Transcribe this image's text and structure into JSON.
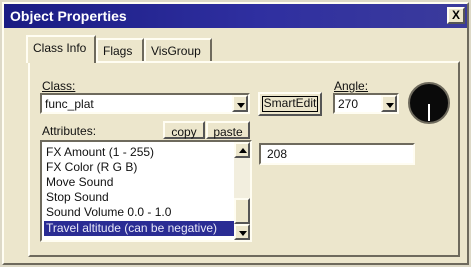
{
  "window": {
    "title": "Object Properties",
    "close_label": "X"
  },
  "tabs": [
    {
      "label": "Class Info",
      "active": true
    },
    {
      "label": "Flags",
      "active": false
    },
    {
      "label": "VisGroup",
      "active": false
    }
  ],
  "class_section": {
    "label": "Class:",
    "value": "func_plat"
  },
  "smartedit_label": "SmartEdit",
  "angle": {
    "label": "Angle:",
    "value": "270",
    "dial_degrees": 270
  },
  "attributes": {
    "label": "Attributes:",
    "copy_label": "copy",
    "paste_label": "paste",
    "items": [
      "FX Amount (1 - 255)",
      "FX Color (R G B)",
      "Move Sound",
      "Stop Sound",
      "Sound Volume 0.0 - 1.0",
      "Travel altitude (can be negative)"
    ],
    "selected_index": 5
  },
  "value_field": {
    "value": "208"
  },
  "colors": {
    "titlebar": "#1a1c83",
    "selection": "#2a2c94",
    "face": "#ece6cc"
  }
}
